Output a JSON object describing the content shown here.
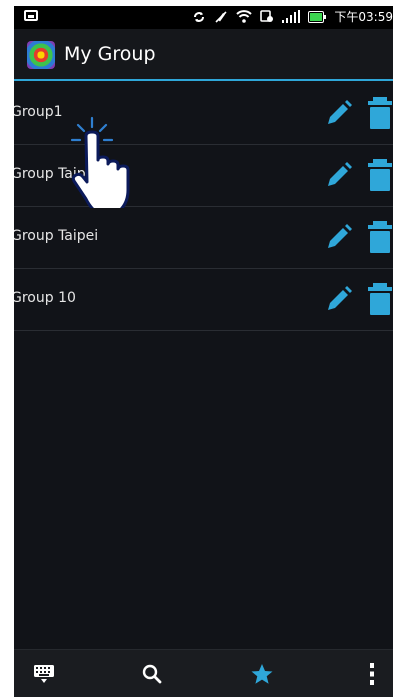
{
  "status_bar": {
    "time": "下午03:59"
  },
  "header": {
    "title": "My Group"
  },
  "groups": [
    {
      "name": "Group1"
    },
    {
      "name": "Group Taipei"
    },
    {
      "name": "Group Taipei"
    },
    {
      "name": "Group 10"
    }
  ],
  "bottom_bar": {
    "items": [
      "keyboard-icon",
      "search-icon",
      "star-icon",
      "overflow-menu-icon"
    ]
  },
  "colors": {
    "accent": "#2fa7d9",
    "background": "#111318",
    "text": "#e6e6e6"
  }
}
